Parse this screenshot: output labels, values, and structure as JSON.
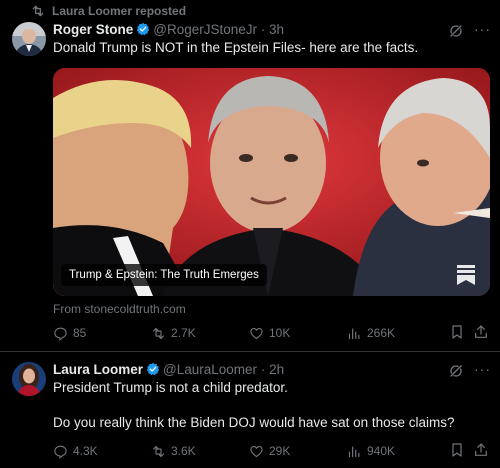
{
  "repost": {
    "label": "Laura Loomer reposted",
    "icon": "repost-icon"
  },
  "tweet1": {
    "name": "Roger Stone",
    "handle": "@RogerJStoneJr",
    "dot": "·",
    "time": "3h",
    "text": "Donald Trump is NOT in the Epstein Files- here are the facts.",
    "card": {
      "label": "Trump & Epstein: The Truth Emerges",
      "from": "From stonecoldtruth.com"
    },
    "stats": {
      "replies": "85",
      "reposts": "2.7K",
      "likes": "10K",
      "views": "266K"
    }
  },
  "tweet2": {
    "name": "Laura Loomer",
    "handle": "@LauraLoomer",
    "dot": "·",
    "time": "2h",
    "text_line1": "President Trump is not a child predator.",
    "text_line2": "Do you really think the Biden DOJ would have sat on those claims?",
    "stats": {
      "replies": "4.3K",
      "reposts": "3.6K",
      "likes": "29K",
      "views": "940K"
    }
  },
  "colors": {
    "background": "#000000",
    "text": "#e7e9ea",
    "muted": "#71767b",
    "verified": "#1d9bf0",
    "card_red": "#b5252a"
  }
}
